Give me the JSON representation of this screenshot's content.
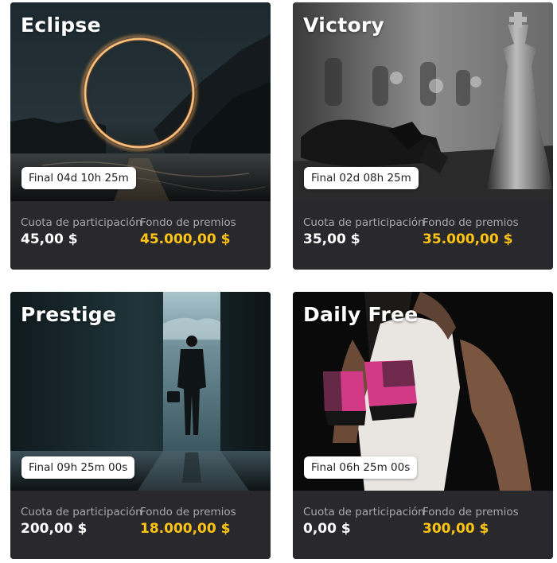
{
  "labels": {
    "fee_label": "Cuota de participación",
    "prize_label": "Fondo de premios"
  },
  "colors": {
    "card_bg": "#29292d",
    "prize_accent": "#ffc414",
    "timer_bg": "#ffffff"
  },
  "tournaments": [
    {
      "title": "Eclipse",
      "timer": "Final 04d 10h 25m",
      "fee": "45,00 $",
      "prize": "45.000,00 $",
      "image": "eclipse-ring-image"
    },
    {
      "title": "Victory",
      "timer": "Final 02d 08h 25m",
      "fee": "35,00 $",
      "prize": "35.000,00 $",
      "image": "chess-pieces-image"
    },
    {
      "title": "Prestige",
      "timer": "Final 09h 25m 00s",
      "fee": "200,00 $",
      "prize": "18.000,00 $",
      "image": "businessman-doorway-image"
    },
    {
      "title": "Daily Free",
      "timer": "Final 06h 25m 00s",
      "fee": "0,00 $",
      "prize": "300,00 $",
      "image": "boxing-athlete-image"
    }
  ]
}
